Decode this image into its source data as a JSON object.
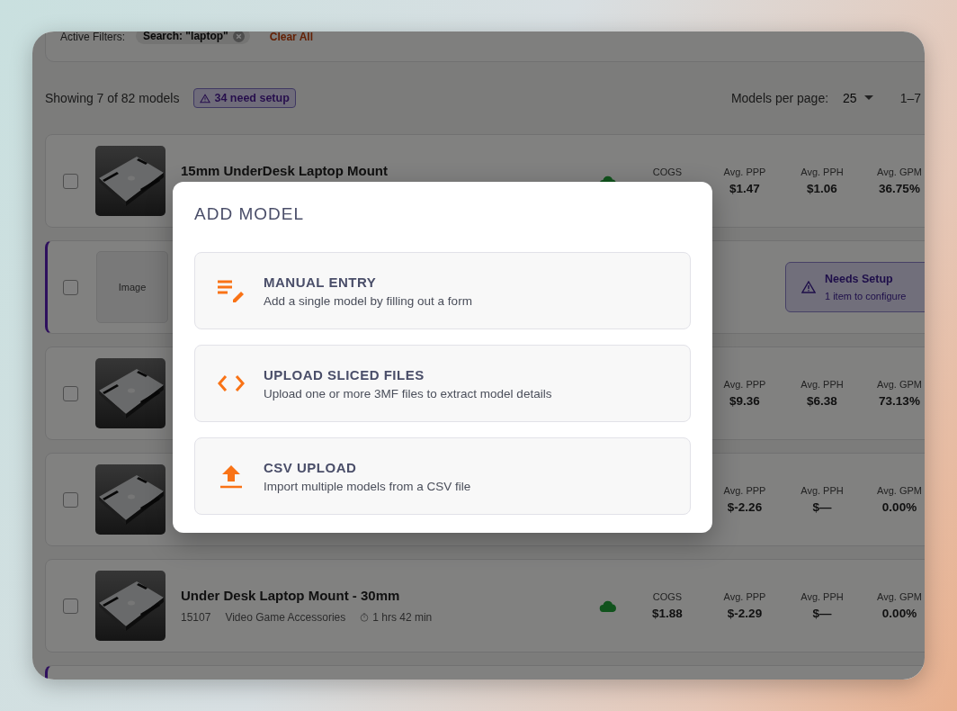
{
  "filters": {
    "label": "Active Filters:",
    "chips": [
      {
        "text": "Search: \"laptop\""
      }
    ],
    "clear": "Clear All"
  },
  "summary": {
    "showing": "Showing 7 of 82 models",
    "setup_badge": "34 need setup",
    "per_page_label": "Models per page:",
    "per_page": "25",
    "range": "1–7"
  },
  "rows": [
    {
      "kind": "model",
      "checked": false,
      "image": {
        "kind": "picture"
      },
      "title": "15mm UnderDesk Laptop Mount",
      "synced": true,
      "stats": [
        {
          "label": "COGS"
        },
        {
          "label": "Avg. PPP",
          "value": "$1.47"
        },
        {
          "label": "Avg. PPH",
          "value": "$1.06"
        },
        {
          "label": "Avg. GPM",
          "value": "36.75%"
        }
      ]
    },
    {
      "kind": "setup",
      "checked": false,
      "image": {
        "kind": "placeholder",
        "text": "Image"
      },
      "setup": {
        "title": "Needs Setup",
        "detail": "1 item to configure"
      }
    },
    {
      "kind": "model",
      "checked": false,
      "image": {
        "kind": "picture"
      },
      "stats": [
        {
          "label": "Avg. PPP",
          "value": "$9.36"
        },
        {
          "label": "Avg. PPH",
          "value": "$6.38"
        },
        {
          "label": "Avg. GPM",
          "value": "73.13%"
        }
      ]
    },
    {
      "kind": "model",
      "checked": false,
      "image": {
        "kind": "picture"
      },
      "stats": [
        {
          "label": "Avg. PPP",
          "value": "$-2.26"
        },
        {
          "label": "Avg. PPH",
          "value": "$—"
        },
        {
          "label": "Avg. GPM",
          "value": "0.00%"
        }
      ]
    },
    {
      "kind": "model",
      "checked": false,
      "image": {
        "kind": "picture"
      },
      "title": "Under Desk Laptop Mount - 30mm",
      "meta": [
        "15107",
        "Video Game Accessories"
      ],
      "duration": "1 hrs 42 min",
      "synced": true,
      "stats": [
        {
          "label": "COGS",
          "value": "$1.88"
        },
        {
          "label": "Avg. PPP",
          "value": "$-2.29"
        },
        {
          "label": "Avg. PPH",
          "value": "$—"
        },
        {
          "label": "Avg. GPM",
          "value": "0.00%"
        }
      ]
    },
    {
      "kind": "setup"
    }
  ],
  "modal": {
    "title": "ADD MODEL",
    "options": [
      {
        "kind": "manual",
        "title": "MANUAL ENTRY",
        "description": "Add a single model by filling out a form"
      },
      {
        "kind": "sliced",
        "title": "UPLOAD SLICED FILES",
        "description": "Upload one or more 3MF files to extract model details"
      },
      {
        "kind": "csv",
        "title": "CSV UPLOAD",
        "description": "Import multiple models from a CSV file"
      }
    ]
  }
}
